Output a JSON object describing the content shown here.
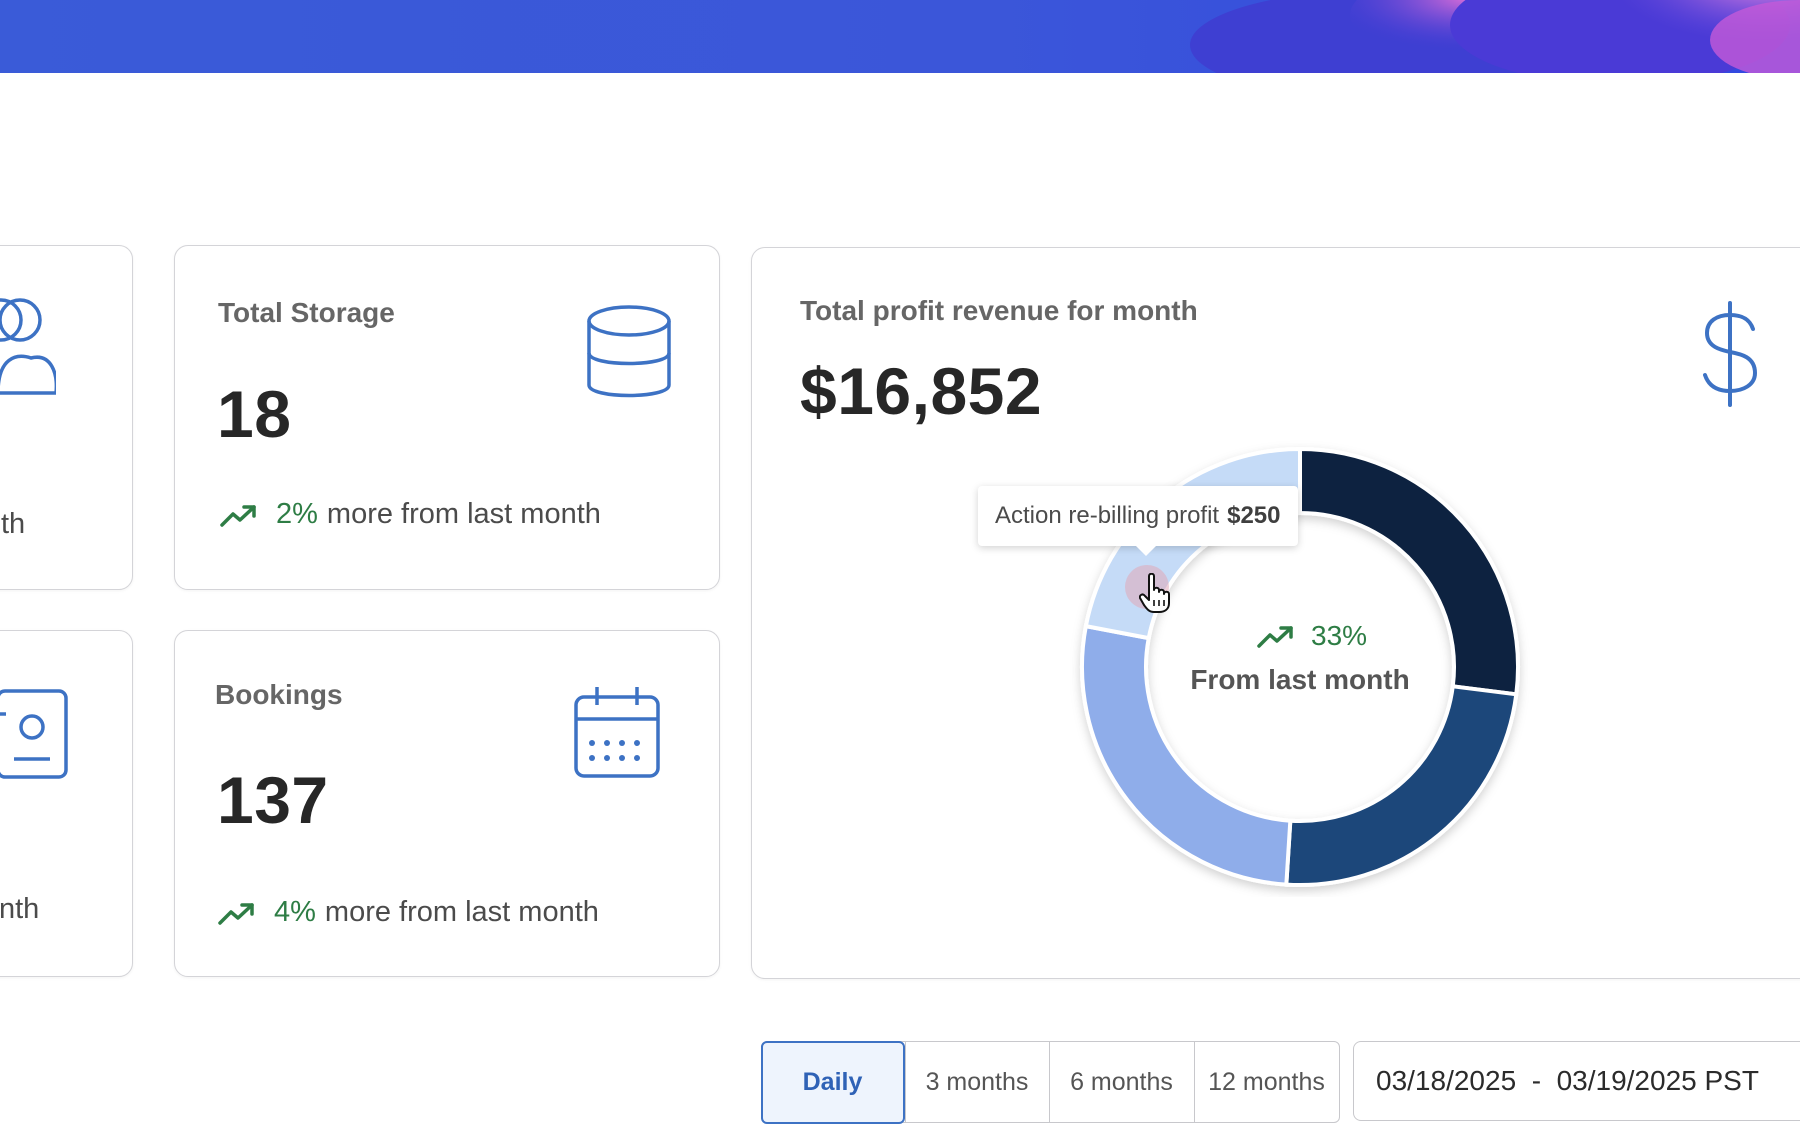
{
  "cards": {
    "storage": {
      "title": "Total Storage",
      "value": "18",
      "trend_pct": "2%",
      "trend_text": "more from last month"
    },
    "bookings": {
      "title": "Bookings",
      "value": "137",
      "trend_pct": "4%",
      "trend_text": "more from last month"
    },
    "partial_top": {
      "text": "th"
    },
    "partial_bottom": {
      "text": "nth"
    }
  },
  "revenue": {
    "title": "Total profit revenue for month",
    "value": "$16,852",
    "center_pct": "33%",
    "center_label": "From last month",
    "tooltip_label": "Action re-billing profit",
    "tooltip_value": "$250"
  },
  "chart_data": {
    "type": "pie",
    "donut": true,
    "slices": [
      {
        "value": 27,
        "color": "#0b2240"
      },
      {
        "value": 24,
        "color": "#1d477a"
      },
      {
        "value": 27,
        "color": "#8fadea"
      },
      {
        "value": 22,
        "color": "#c5dbf7"
      }
    ]
  },
  "period": {
    "buttons": [
      "Daily",
      "3 months",
      "6 months",
      "12 months"
    ],
    "active": "Daily"
  },
  "date_range": {
    "text": "03/18/2025  -  03/19/2025 PST"
  },
  "icons": {
    "users": "users-icon",
    "contact": "contact-card-icon",
    "storage": "database-icon",
    "bookings": "calendar-icon",
    "revenue": "dollar-icon",
    "trend": "trending-up-icon",
    "cursor": "hand-pointer-icon",
    "calendar_picker": "calendar-picker-icon"
  },
  "colors": {
    "accent": "#3d72c4",
    "positive": "#2e7d45",
    "banner": "#3a55d9"
  }
}
